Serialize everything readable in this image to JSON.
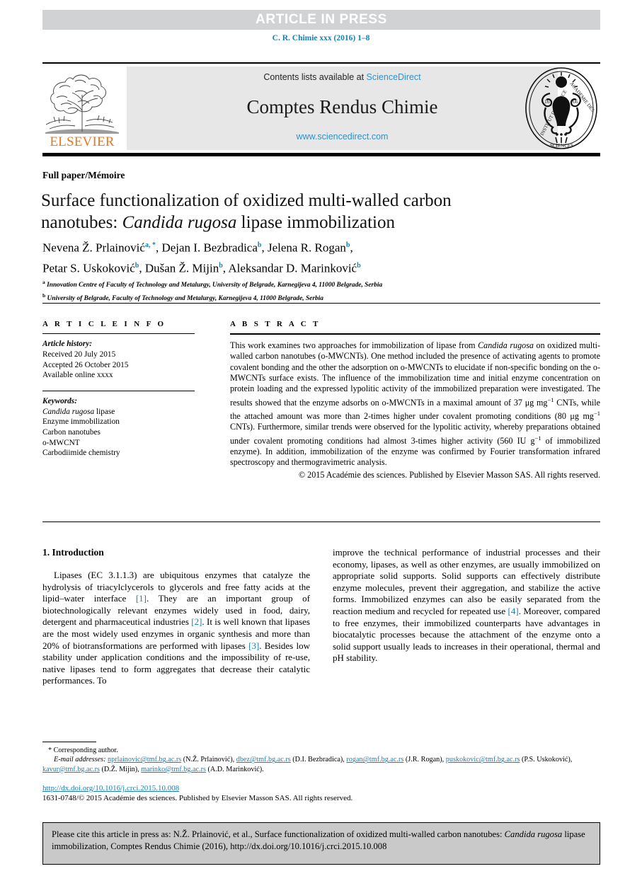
{
  "banner": {
    "article_in_press": "ARTICLE IN PRESS",
    "journal_reference": "C. R. Chimie xxx (2016) 1–8"
  },
  "masthead": {
    "contents_prefix": "Contents lists available at ",
    "sciencedirect": "ScienceDirect",
    "journal_title": "Comptes Rendus Chimie",
    "url": "www.sciencedirect.com",
    "elsevier_wordmark": "ELSEVIER",
    "colors": {
      "band_gray": "#d1d2d4",
      "panel_gray": "#e7e7e7",
      "link_blue": "#2f91c8",
      "elsevier_orange": "#e87722",
      "ref_blue": "#1a7fb5"
    }
  },
  "article": {
    "paper_type": "Full paper/Mémoire",
    "title_line1": "Surface functionalization of oxidized multi-walled carbon",
    "title_line2_pre": "nanotubes: ",
    "title_line2_italic": "Candida rugosa",
    "title_line2_post": " lipase immobilization",
    "authors": [
      {
        "name": "Nevena Ž. Prlainović",
        "marks": "a, *",
        "sep": ", "
      },
      {
        "name": "Dejan I. Bezbradica",
        "marks": "b",
        "sep": ", "
      },
      {
        "name": "Jelena R. Rogan",
        "marks": "b",
        "sep": ", "
      },
      {
        "name": "Petar S. Uskoković",
        "marks": "b",
        "sep": ", "
      },
      {
        "name": "Dušan Ž. Mijin",
        "marks": "b",
        "sep": ", "
      },
      {
        "name": "Aleksandar D. Marinković",
        "marks": "b",
        "sep": ""
      }
    ],
    "affiliations": [
      {
        "mark": "a",
        "text": "Innovation Centre of Faculty of Technology and Metalurgy, University of Belgrade, Karnegijeva 4, 11000 Belgrade, Serbia"
      },
      {
        "mark": "b",
        "text": "University of Belgrade, Faculty of Technology and Metalurgy, Karnegijeva 4, 11000 Belgrade, Serbia"
      }
    ]
  },
  "article_info": {
    "heading": "A R T I C L E   I N F O",
    "history_label": "Article history:",
    "history": [
      "Received 20 July 2015",
      "Accepted 26 October 2015",
      "Available online xxxx"
    ],
    "keywords_label": "Keywords:",
    "keywords": [
      {
        "italic": "Candida rugosa",
        "rest": " lipase"
      },
      {
        "italic": "",
        "rest": "Enzyme immobilization"
      },
      {
        "italic": "",
        "rest": "Carbon nanotubes"
      },
      {
        "italic": "",
        "rest": "o-MWCNT"
      },
      {
        "italic": "",
        "rest": "Carbodiimide chemistry"
      }
    ]
  },
  "abstract": {
    "heading": "A B S T R A C T",
    "p1_a": "This work examines two approaches for immobilization of lipase from ",
    "p1_italic": "Candida rugosa",
    "p1_b": " on oxidized multi-walled carbon nanotubes (o-MWCNTs). One method included the presence of activating agents to promote covalent bonding and the other the adsorption on o-MWCNTs to elucidate if non-specific bonding on the o-MWCNTs surface exists. The influence of the immobilization time and initial enzyme concentration on protein loading and the expressed lypolitic activity of the immobilized preparation were investigated. The results showed that the enzyme adsorbs on o-MWCNTs in a maximal amount of 37 μg mg",
    "p1_sup1": "−1",
    "p1_c": " CNTs, while the attached amount was more than 2-times higher under covalent promoting conditions (80 μg mg",
    "p1_sup2": "−1",
    "p1_d": " CNTs). Furthermore, similar trends were observed for the lypolitic activity, whereby preparations obtained under covalent promoting conditions had almost 3-times higher activity (560 IU g",
    "p1_sup3": "−1",
    "p1_e": " of immobilized enzyme). In addition, immobilization of the enzyme was confirmed by Fourier transformation infrared spectroscopy and thermogravimetric analysis.",
    "copyright": "© 2015 Académie des sciences. Published by Elsevier Masson SAS. All rights reserved."
  },
  "introduction": {
    "section_title": "1. Introduction",
    "left_para_1": "Lipases (EC 3.1.1.3) are ubiquitous enzymes that catalyze the hydrolysis of triacylclycerols to glycerols and free fatty acids at the lipid–water interface ",
    "ref1": "[1]",
    "left_para_2": ". They are an important group of biotechnologically relevant enzymes widely used in food, dairy, detergent and pharmaceutical industries ",
    "ref2": "[2]",
    "left_para_3": ". It is well known that lipases are the most widely used enzymes in organic synthesis and more than 20% of biotransformations are performed with lipases ",
    "ref3": "[3]",
    "left_para_4": ". Besides low stability under application conditions and the impossibility of re-use, native lipases tend to form aggregates that decrease their catalytic performances. To",
    "right_para_1": "improve the technical performance of industrial processes and their economy, lipases, as well as other enzymes, are usually immobilized on appropriate solid supports. Solid supports can effectively distribute enzyme molecules, prevent their aggregation, and stabilize the active forms. Immobilized enzymes can also be easily separated from the reaction medium and recycled for repeated use ",
    "ref4": "[4]",
    "right_para_2": ". Moreover, compared to free enzymes, their immobilized counterparts have advantages in biocatalytic processes because the attachment of the enzyme onto a solid support usually leads to increases in their operational, thermal and pH stability."
  },
  "footnotes": {
    "corresponding": "* Corresponding author.",
    "email_label": "E-mail addresses:",
    "emails": [
      {
        "address": "nprlainovic@tmf.bg.ac.rs",
        "owner": " (N.Ž. Prlainović), "
      },
      {
        "address": "dbez@tmf.bg.ac.rs",
        "owner": " (D.I. Bezbradica), "
      },
      {
        "address": "rogan@tmf.bg.ac.rs",
        "owner": " (J.R. Rogan), "
      },
      {
        "address": "puskokovic@tmf.bg.ac.rs",
        "owner": " (P.S. Uskoković), "
      },
      {
        "address": "kavur@tmf.bg.ac.rs",
        "owner": " (D.Ž. Mijin), "
      },
      {
        "address": "marinko@tmf.bg.ac.rs",
        "owner": " (A.D. Marinković)."
      }
    ],
    "doi": "http://dx.doi.org/10.1016/j.crci.2015.10.008",
    "issn_line": "1631-0748/© 2015 Académie des sciences. Published by Elsevier Masson SAS. All rights reserved."
  },
  "cite_box": {
    "line1": "Please cite this article in press as: N.Ž. Prlainović, et al., Surface functionalization of oxidized multi-walled carbon nanotubes:",
    "line2_italic": "Candida rugosa",
    "line2_rest": " lipase immobilization, Comptes Rendus Chimie (2016), http://dx.doi.org/10.1016/j.crci.2015.10.008"
  }
}
